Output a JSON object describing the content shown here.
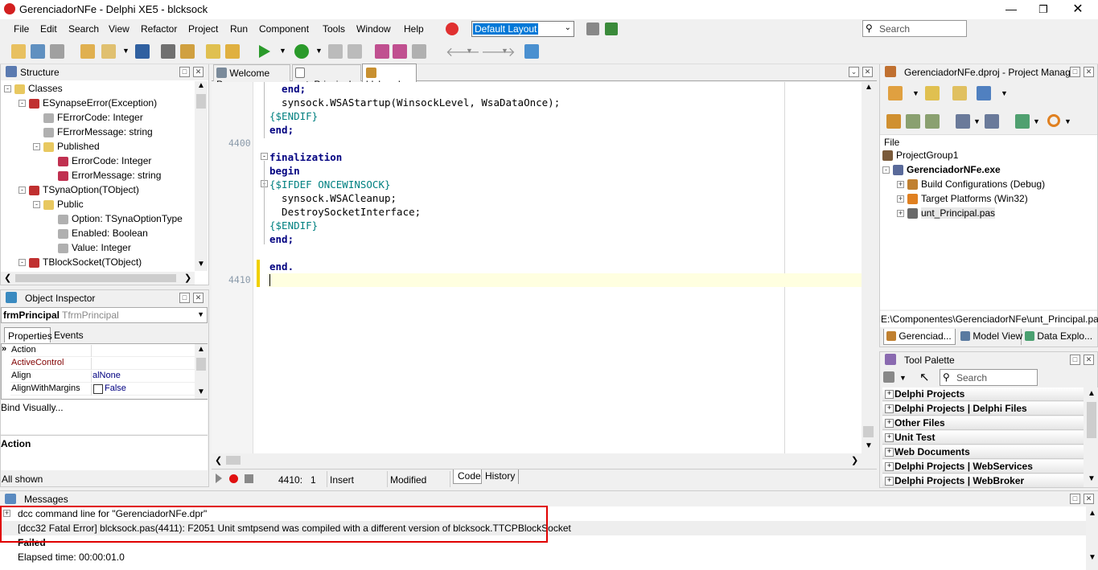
{
  "window": {
    "title": "GerenciadorNFe - Delphi XE5 - blcksock"
  },
  "menu": [
    "File",
    "Edit",
    "Search",
    "View",
    "Refactor",
    "Project",
    "Run",
    "Component",
    "Tools",
    "Window",
    "Help"
  ],
  "layout_select": "Default Layout",
  "search_placeholder": "Search",
  "structure": {
    "title": "Structure",
    "items": [
      {
        "label": "Classes",
        "indent": 0,
        "kind": "folder",
        "exp": "-"
      },
      {
        "label": "ESynapseError(Exception)",
        "indent": 1,
        "kind": "class",
        "exp": "-"
      },
      {
        "label": "FErrorCode: Integer",
        "indent": 2,
        "kind": "field",
        "exp": ""
      },
      {
        "label": "FErrorMessage: string",
        "indent": 2,
        "kind": "field",
        "exp": ""
      },
      {
        "label": "Published",
        "indent": 2,
        "kind": "folder",
        "exp": "-"
      },
      {
        "label": "ErrorCode: Integer",
        "indent": 3,
        "kind": "prop",
        "exp": ""
      },
      {
        "label": "ErrorMessage: string",
        "indent": 3,
        "kind": "prop",
        "exp": ""
      },
      {
        "label": "TSynaOption(TObject)",
        "indent": 1,
        "kind": "class",
        "exp": "-"
      },
      {
        "label": "Public",
        "indent": 2,
        "kind": "folder",
        "exp": "-"
      },
      {
        "label": "Option: TSynaOptionType",
        "indent": 3,
        "kind": "field",
        "exp": ""
      },
      {
        "label": "Enabled: Boolean",
        "indent": 3,
        "kind": "field",
        "exp": ""
      },
      {
        "label": "Value: Integer",
        "indent": 3,
        "kind": "field",
        "exp": ""
      },
      {
        "label": "TBlockSocket(TObject)",
        "indent": 1,
        "kind": "class",
        "exp": "-"
      }
    ]
  },
  "object_inspector": {
    "title": "Object Inspector",
    "object_name": "frmPrincipal",
    "object_type": "TfrmPrincipal",
    "tabs": [
      "Properties",
      "Events"
    ],
    "rows": [
      {
        "name": "Action",
        "value": "",
        "color": "#000"
      },
      {
        "name": "ActiveControl",
        "value": "",
        "color": "#800000"
      },
      {
        "name": "Align",
        "value": "alNone",
        "color": "#000"
      },
      {
        "name": "AlignWithMargins",
        "value": "False",
        "color": "#000"
      }
    ],
    "bind_visually": "Bind Visually...",
    "desc_title": "Action",
    "all_shown": "All shown"
  },
  "editor": {
    "tabs": [
      "Welcome Page",
      "unt_Principal",
      "blcksock"
    ],
    "lines": [
      {
        "num": "",
        "html": "    end;",
        "type": "kwline"
      },
      {
        "num": "",
        "text": "    synsock.WSAStartup(WinsockLevel, WsaDataOnce);",
        "type": "plain"
      },
      {
        "num": "",
        "text": "  {$ENDIF}",
        "type": "dir"
      },
      {
        "num": "",
        "text": "  end;",
        "type": "kw"
      },
      {
        "num": "4400",
        "text": "",
        "type": "plain"
      },
      {
        "num": "",
        "text": "  finalization",
        "type": "kw"
      },
      {
        "num": "",
        "text": "  begin",
        "type": "kw"
      },
      {
        "num": "",
        "text": "  {$IFDEF ONCEWINSOCK}",
        "type": "dir"
      },
      {
        "num": "",
        "text": "    synsock.WSACleanup;",
        "type": "plain"
      },
      {
        "num": "",
        "text": "    DestroySocketInterface;",
        "type": "plain"
      },
      {
        "num": "",
        "text": "  {$ENDIF}",
        "type": "dir"
      },
      {
        "num": "",
        "text": "  end;",
        "type": "kw"
      },
      {
        "num": "",
        "text": "",
        "type": "plain"
      },
      {
        "num": "",
        "text": "  end.",
        "type": "kw"
      },
      {
        "num": "4410",
        "text": "",
        "type": "plain"
      }
    ],
    "status": {
      "position": "4410:   1",
      "mode": "Insert",
      "modified": "Modified"
    },
    "bottom_tabs": [
      "Code",
      "History"
    ]
  },
  "project_manager": {
    "title": "GerenciadorNFe.dproj - Project Manager",
    "column": "File",
    "items": [
      {
        "label": "ProjectGroup1",
        "indent": 0,
        "bold": false,
        "exp": ""
      },
      {
        "label": "GerenciadorNFe.exe",
        "indent": 0,
        "bold": true,
        "exp": "-"
      },
      {
        "label": "Build Configurations (Debug)",
        "indent": 1,
        "bold": false,
        "exp": "+"
      },
      {
        "label": "Target Platforms (Win32)",
        "indent": 1,
        "bold": false,
        "exp": "+"
      },
      {
        "label": "unt_Principal.pas",
        "indent": 1,
        "bold": false,
        "exp": "+"
      }
    ],
    "path": "E:\\Componentes\\GerenciadorNFe\\unt_Principal.pas",
    "tabs": [
      "Gerenciad...",
      "Model View",
      "Data Explo..."
    ]
  },
  "tool_palette": {
    "title": "Tool Palette",
    "search": "Search",
    "categories": [
      "Delphi Projects",
      "Delphi Projects | Delphi Files",
      "Other Files",
      "Unit Test",
      "Web Documents",
      "Delphi Projects | WebServices",
      "Delphi Projects | WebBroker"
    ]
  },
  "messages": {
    "title": "Messages",
    "lines": [
      "dcc command line for \"GerenciadorNFe.dpr\"",
      "[dcc32 Fatal Error] blcksock.pas(4411): F2051 Unit smtpsend was compiled with a different version of blcksock.TTCPBlockSocket",
      "Failed",
      "Elapsed time: 00:00:01.0"
    ]
  },
  "colors": {
    "highlight_box": "#e00000",
    "current_line": "#ffffe0",
    "keyword": "#000080",
    "directive": "#008080"
  }
}
